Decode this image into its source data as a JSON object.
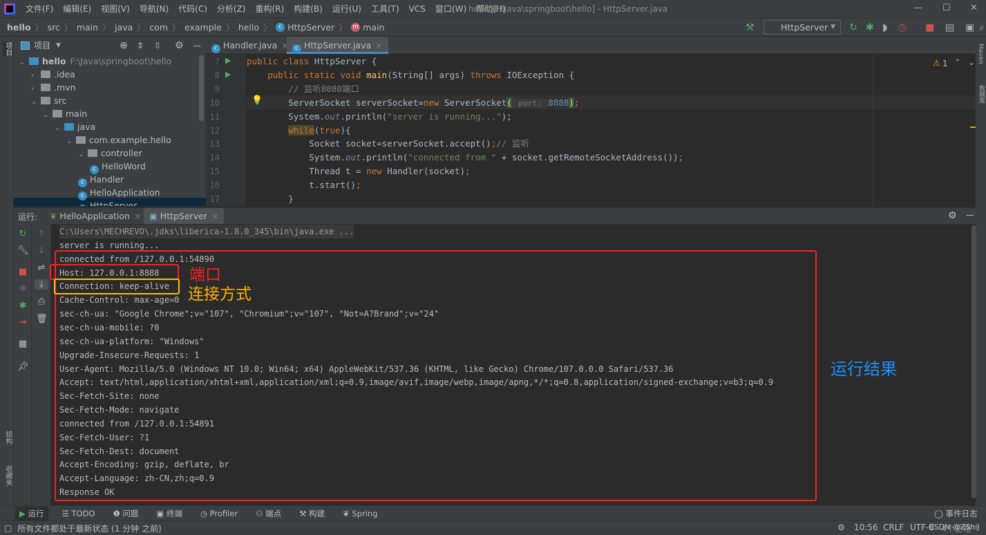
{
  "menubar": {
    "items": [
      "文件(F)",
      "编辑(E)",
      "视图(V)",
      "导航(N)",
      "代码(C)",
      "分析(Z)",
      "重构(R)",
      "构建(B)",
      "运行(U)",
      "工具(T)",
      "VCS",
      "窗口(W)",
      "帮助(H)"
    ],
    "window_title": "hello [F:\\Java\\springboot\\hello] - HttpServer.java"
  },
  "breadcrumb": [
    "hello",
    "src",
    "main",
    "java",
    "com",
    "example",
    "hello",
    "HttpServer",
    "main"
  ],
  "toolbar": {
    "run_config": "HttpServer"
  },
  "project": {
    "title": "项目",
    "tree": [
      {
        "label": "hello",
        "path": "F:\\Java\\springboot\\hello",
        "depth": 0,
        "arrow": "open",
        "icon": "module-folder"
      },
      {
        "label": ".idea",
        "depth": 1,
        "arrow": "closed",
        "icon": "folder"
      },
      {
        "label": ".mvn",
        "depth": 1,
        "arrow": "closed",
        "icon": "folder"
      },
      {
        "label": "src",
        "depth": 1,
        "arrow": "open",
        "icon": "folder"
      },
      {
        "label": "main",
        "depth": 2,
        "arrow": "open",
        "icon": "folder"
      },
      {
        "label": "java",
        "depth": 3,
        "arrow": "open",
        "icon": "source-folder"
      },
      {
        "label": "com.example.hello",
        "depth": 4,
        "arrow": "open",
        "icon": "package"
      },
      {
        "label": "controller",
        "depth": 5,
        "arrow": "open",
        "icon": "package"
      },
      {
        "label": "HelloWord",
        "depth": 6,
        "icon": "class"
      },
      {
        "label": "Handler",
        "depth": 5,
        "icon": "class"
      },
      {
        "label": "HelloApplication",
        "depth": 5,
        "icon": "spring-class"
      },
      {
        "label": "HttpServer",
        "depth": 5,
        "icon": "class",
        "selected": true
      }
    ]
  },
  "editor": {
    "tabs": [
      {
        "label": "Handler.java",
        "active": false
      },
      {
        "label": "HttpServer.java",
        "active": true
      }
    ],
    "inspection": {
      "warnings": "1"
    },
    "lines": [
      {
        "n": "7",
        "segs": [
          [
            "public class ",
            "kw"
          ],
          [
            "HttpServer {",
            ""
          ]
        ]
      },
      {
        "n": "8",
        "segs": [
          [
            "    public static void ",
            "kw"
          ],
          [
            "main",
            "fn"
          ],
          [
            "(String[] args) ",
            ""
          ],
          [
            "throws ",
            "kw"
          ],
          [
            "IOException {",
            ""
          ]
        ]
      },
      {
        "n": "9",
        "segs": [
          [
            "        // 监听8080端口",
            "cm"
          ]
        ]
      },
      {
        "n": "10",
        "segs": [
          [
            "        ServerSocket serverSocket=",
            ""
          ],
          [
            "new ",
            "kw"
          ],
          [
            "ServerSocket",
            ""
          ],
          [
            "(",
            "br"
          ],
          [
            " port: ",
            "hint"
          ],
          [
            "8888",
            "num"
          ],
          [
            ")",
            "br"
          ],
          [
            ";",
            "kw"
          ]
        ]
      },
      {
        "n": "11",
        "segs": [
          [
            "        System.",
            ""
          ],
          [
            "out",
            "it"
          ],
          [
            ".println(",
            ""
          ],
          [
            "\"server is running...\"",
            "str"
          ],
          [
            ");",
            ""
          ]
        ]
      },
      {
        "n": "12",
        "segs": [
          [
            "        ",
            ""
          ],
          [
            "while",
            "hl kw"
          ],
          [
            "(",
            ""
          ],
          [
            "true",
            "kw"
          ],
          [
            "){",
            ""
          ]
        ]
      },
      {
        "n": "13",
        "segs": [
          [
            "            Socket socket=serverSocket.accept()",
            ""
          ],
          [
            ";",
            "kw"
          ],
          [
            "// 监听",
            "cm"
          ]
        ]
      },
      {
        "n": "14",
        "segs": [
          [
            "            System.",
            ""
          ],
          [
            "out",
            "it"
          ],
          [
            ".println(",
            ""
          ],
          [
            "\"connected from \"",
            "str"
          ],
          [
            " + socket.getRemoteSocketAddress())",
            ""
          ],
          [
            ";",
            "kw"
          ]
        ]
      },
      {
        "n": "15",
        "segs": [
          [
            "            Thread t = ",
            ""
          ],
          [
            "new ",
            "kw"
          ],
          [
            "Handler(socket)",
            ""
          ],
          [
            ";",
            "kw"
          ]
        ]
      },
      {
        "n": "16",
        "segs": [
          [
            "            t.start()",
            ""
          ],
          [
            ";",
            "kw"
          ]
        ]
      },
      {
        "n": "17",
        "segs": [
          [
            "        }",
            ""
          ]
        ]
      }
    ]
  },
  "run": {
    "label": "运行:",
    "tabs": [
      {
        "label": "HelloApplication",
        "active": false
      },
      {
        "label": "HttpServer",
        "active": true
      }
    ],
    "console": [
      "C:\\Users\\MECHREVO\\.jdks\\liberica-1.8.0_345\\bin\\java.exe ...",
      "server is running...",
      "connected from /127.0.0.1:54890",
      "Host: 127.0.0.1:8888",
      "Connection: keep-alive",
      "Cache-Control: max-age=0",
      "sec-ch-ua: \"Google Chrome\";v=\"107\", \"Chromium\";v=\"107\", \"Not=A?Brand\";v=\"24\"",
      "sec-ch-ua-mobile: ?0",
      "sec-ch-ua-platform: \"Windows\"",
      "Upgrade-Insecure-Requests: 1",
      "User-Agent: Mozilla/5.0 (Windows NT 10.0; Win64; x64) AppleWebKit/537.36 (KHTML, like Gecko) Chrome/107.0.0.0 Safari/537.36",
      "Accept: text/html,application/xhtml+xml,application/xml;q=0.9,image/avif,image/webp,image/apng,*/*;q=0.8,application/signed-exchange;v=b3;q=0.9",
      "Sec-Fetch-Site: none",
      "Sec-Fetch-Mode: navigate",
      "connected from /127.0.0.1:54891",
      "Sec-Fetch-User: ?1",
      "Sec-Fetch-Dest: document",
      "Accept-Encoding: gzip, deflate, br",
      "Accept-Language: zh-CN,zh;q=0.9",
      "Response OK"
    ]
  },
  "annotations": {
    "port": "端口",
    "connection": "连接方式",
    "result": "运行结果",
    "colors": {
      "red": "#ff2020",
      "yellow": "#ffc000",
      "blue": "#1e90ff"
    }
  },
  "bottom_tools": [
    "运行",
    "TODO",
    "问题",
    "终端",
    "Profiler",
    "端点",
    "构建",
    "Spring"
  ],
  "statusbar": {
    "message": "所有文件都处于最新状态 (1 分钟 之前)",
    "event_log": "事件日志",
    "position": "10:56",
    "line_sep": "CRLF",
    "encoding": "UTF-8",
    "indent": "4个空格",
    "watermark": "CSDN @ZShiJ"
  },
  "side_stripes": {
    "left_top": "项目",
    "left_bottom1": "结构",
    "left_bottom2": "收藏夹",
    "right1": "Maven",
    "right2": "数据库"
  }
}
